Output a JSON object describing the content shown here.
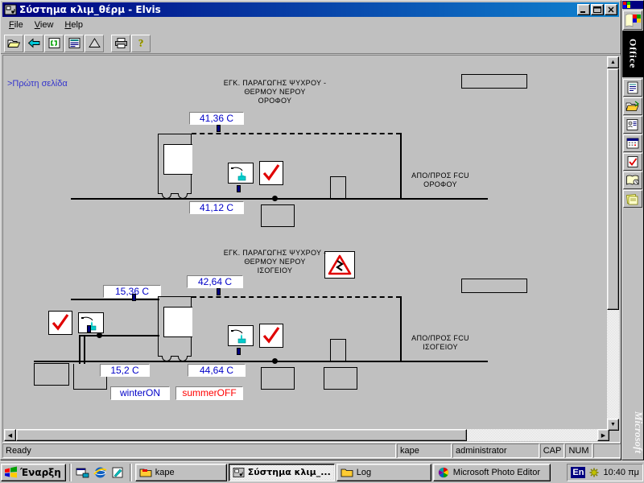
{
  "window": {
    "title": "Σύστημα κλιμ_θέρμ - Elvis",
    "icon": "hvac-app-icon",
    "minimize_label": "_",
    "maximize_label": "□",
    "close_label": "✕"
  },
  "menu": {
    "items": [
      {
        "label": "File",
        "name": "menu-file"
      },
      {
        "label": "View",
        "name": "menu-view"
      },
      {
        "label": "Help",
        "name": "menu-help"
      }
    ]
  },
  "toolbar": {
    "buttons": [
      {
        "name": "open-folder-icon",
        "title": "Open"
      },
      {
        "name": "back-arrow-icon",
        "title": "Back"
      },
      {
        "name": "refresh-icon",
        "title": "Refresh"
      },
      {
        "name": "properties-icon",
        "title": "Properties"
      },
      {
        "name": "alarm-icon",
        "title": "Alarms"
      },
      {
        "name": "print-icon",
        "title": "Print"
      },
      {
        "name": "help-icon",
        "title": "Help"
      }
    ]
  },
  "diagram": {
    "first_page_link": ">Πρώτη σελίδα",
    "upper_plant": {
      "title": "ΕΓΚ. ΠΑΡΑΓΩΓΗΣ ΨΥΧΡΟΥ -\nΘΕΡΜΟΥ ΝΕΡΟΥ\nΟΡΟΦΟΥ",
      "fcu_label": "ΑΠΟ/ΠΡΟΣ  FCU\nΟΡΟΦΟΥ",
      "supply_temp": "41,36  C",
      "return_temp": "41,12  C"
    },
    "lower_plant": {
      "title": "ΕΓΚ. ΠΑΡΑΓΩΓΗΣ ΨΥΧΡΟΥ -\nΘΕΡΜΟΥ ΝΕΡΟΥ\nΙΣΟΓΕΙΟΥ",
      "fcu_label": "ΑΠΟ/ΠΡΟΣ  FCU\nΙΣΟΓΕΙΟΥ",
      "supply_temp": "42,64  C",
      "return_temp": "44,64  C",
      "tank_temp_top": "15,36  C",
      "tank_temp_bottom": "15,2  C"
    },
    "mode": {
      "winter_label": "winterON",
      "summer_label": "summerOFF"
    },
    "icons": {
      "water_flow": "water-flow-icon",
      "check_ok": "red-check-icon",
      "warning": "warning-triangle-icon"
    },
    "colors": {
      "readout_text": "#0000c8",
      "alarm_text": "#ff0000",
      "link_text": "#3333cc",
      "panel_bg": "#c0c0c0"
    }
  },
  "status_bar": {
    "message": "Ready",
    "site": "kape",
    "user": "administrator",
    "caps": "CAP",
    "num": "NUM",
    "extra": ""
  },
  "office_bar": {
    "label": "Office",
    "watermark": "Microsoft",
    "buttons": [
      {
        "name": "office-logo-icon"
      },
      {
        "name": "new-document-icon"
      },
      {
        "name": "open-office-document-icon"
      },
      {
        "name": "contacts-icon"
      },
      {
        "name": "calendar-icon"
      },
      {
        "name": "tasks-icon"
      },
      {
        "name": "journal-icon"
      },
      {
        "name": "notes-icon"
      },
      {
        "name": "sticky-note-icon"
      }
    ]
  },
  "taskbar": {
    "start_label": "Έναρξη",
    "quick_launch": [
      {
        "name": "show-desktop-icon"
      },
      {
        "name": "internet-explorer-icon"
      },
      {
        "name": "paint-icon"
      }
    ],
    "tasks": [
      {
        "label": "kape",
        "name": "task-kape",
        "icon": "folder-kape-icon",
        "active": false
      },
      {
        "label": "Σύστημα κλιμ_...",
        "name": "task-systima-klim",
        "icon": "hvac-app-icon",
        "active": true
      },
      {
        "label": "Log",
        "name": "task-log",
        "icon": "folder-icon",
        "active": false
      },
      {
        "label": "Microsoft Photo Editor",
        "name": "task-photo-editor",
        "icon": "photo-editor-icon",
        "active": false
      }
    ],
    "tray": {
      "language": "En",
      "clock": "10:40 πμ"
    }
  }
}
